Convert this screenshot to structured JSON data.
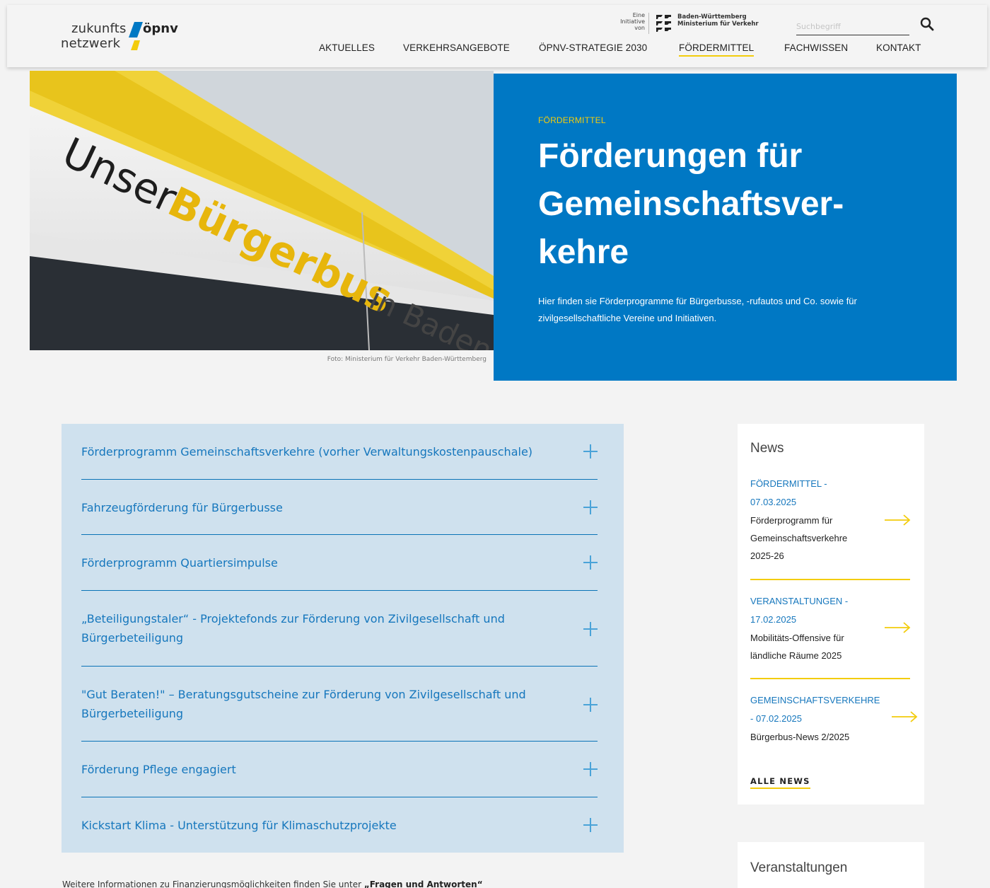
{
  "header": {
    "logo": {
      "line1": "zukunfts",
      "line2": "netzwerk",
      "line3": "öpnv"
    },
    "initiative": {
      "line1": "Eine",
      "line2": "Initiative",
      "line3": "von",
      "ministry_line1": "Baden-Württemberg",
      "ministry_line2": "Ministerium für Verkehr"
    },
    "search": {
      "placeholder": "Suchbegriff"
    },
    "nav": [
      {
        "label": "AKTUELLES"
      },
      {
        "label": "VERKEHRSANGEBOTE"
      },
      {
        "label": "ÖPNV-STRATEGIE 2030"
      },
      {
        "label": "FÖRDERMITTEL",
        "active": true
      },
      {
        "label": "FACHWISSEN"
      },
      {
        "label": "KONTAKT"
      }
    ]
  },
  "hero": {
    "photo_text": {
      "word1": "Unser",
      "word2": "Bürgerbus",
      "word3": "in Baden-Württemberg"
    },
    "photo_credit": "Foto: Ministerium für Verkehr Baden-Württemberg",
    "eyebrow": "FÖRDERMITTEL",
    "title_line1": "Förderungen für",
    "title_line2": "Gemeinschaftsver-",
    "title_line3": "kehre",
    "intro": "Hier finden sie Förderprogramme für Bürgerbusse, -rufautos und Co. sowie für zivilgesellschaftliche Vereine und Initiativen."
  },
  "accordion": [
    {
      "label": "Förderprogramm Gemeinschaftsverkehre (vorher Verwaltungskostenpauschale)"
    },
    {
      "label": "Fahrzeugförderung für Bürgerbusse"
    },
    {
      "label": "Förderprogramm Quartiersimpulse"
    },
    {
      "label": "„Beteiligungstaler“ - Projektefonds zur Förderung von Zivilgesellschaft und Bürgerbeteiligung"
    },
    {
      "label": "\"Gut Beraten!\" – Beratungsgutscheine zur Förderung von Zivilgesellschaft und Bürgerbeteiligung"
    },
    {
      "label": "Förderung Pflege engagiert"
    },
    {
      "label": "Kickstart Klima - Unterstützung für Klimaschutzprojekte"
    }
  ],
  "more_info": {
    "prefix": "Weitere Informationen zu Finanzierungsmöglichkeiten finden Sie unter",
    "link": "„Fragen und Antworten“"
  },
  "news": {
    "title": "News",
    "items": [
      {
        "category": "FÖRDERMITTEL -",
        "date": "07.03.2025",
        "headline": "Förderprogramm für Gemeinschaftsverkehre 2025-26"
      },
      {
        "category": "VERANSTALTUNGEN -",
        "date": "17.02.2025",
        "headline": "Mobilitäts-Offensive für ländliche Räume 2025"
      },
      {
        "category": "GEMEINSCHAFTSVERKEHRE",
        "date": "- 07.02.2025",
        "headline": "Bürgerbus-News 2/2025"
      }
    ],
    "all_label": "ALLE NEWS"
  },
  "events": {
    "title": "Veranstaltungen"
  },
  "colors": {
    "brand_blue": "#0078c4",
    "accent_yellow": "#f3cc0c",
    "link_blue": "#1677bd",
    "accordion_bg": "#cfe1ee"
  }
}
